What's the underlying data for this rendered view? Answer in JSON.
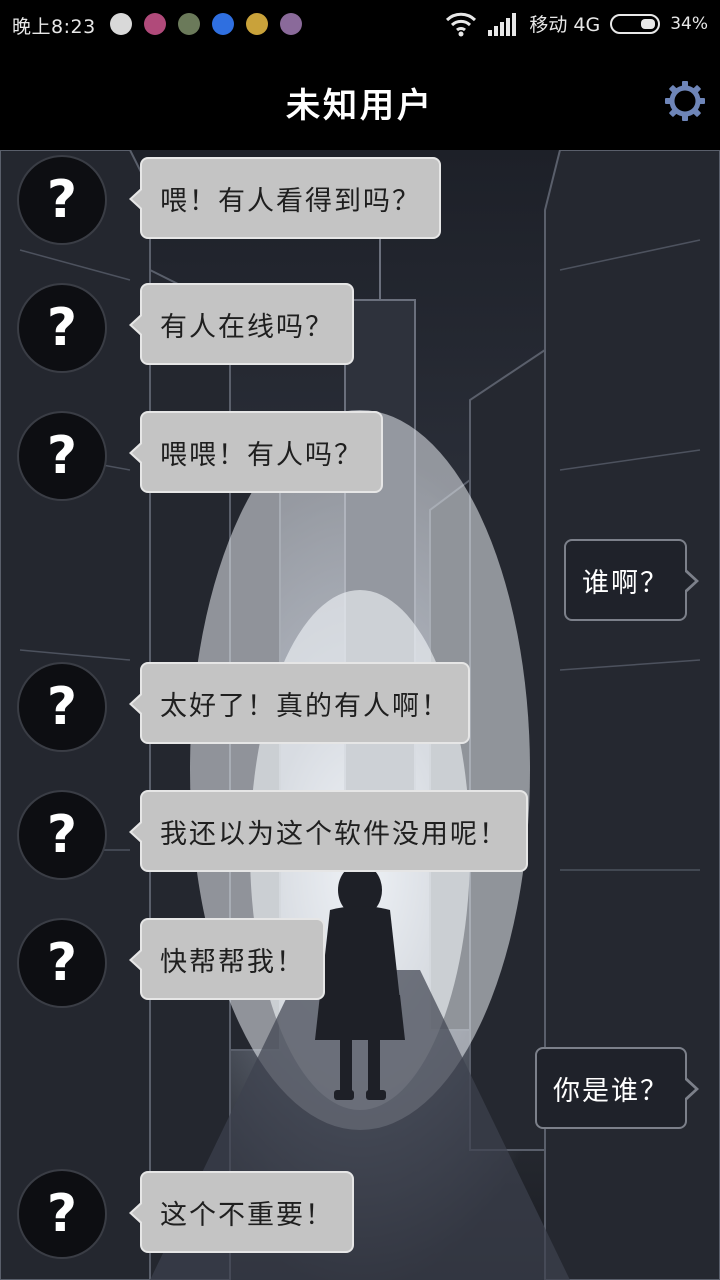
{
  "status_bar": {
    "time": "晚上8:23",
    "carrier": "移动 4G",
    "battery_percent": "34%",
    "battery_level": 0.34,
    "notification_icons": [
      "app-icon",
      "app-icon",
      "app-icon",
      "shield-check-icon",
      "app-icon",
      "app-icon"
    ],
    "notification_colors": [
      "#d9d9d9",
      "#b04a7a",
      "#6b7a5a",
      "#2f6fe0",
      "#c9a23a",
      "#8a6a9a"
    ]
  },
  "header": {
    "title": "未知用户",
    "settings_icon": "gear-icon",
    "accent_color": "#6e85b8"
  },
  "messages": [
    {
      "side": "incoming",
      "avatar_text": "?",
      "text": "喂！有人看得到吗？"
    },
    {
      "side": "incoming",
      "avatar_text": "?",
      "text": "有人在线吗？"
    },
    {
      "side": "incoming",
      "avatar_text": "?",
      "text": "喂喂！有人吗？"
    },
    {
      "side": "outgoing",
      "text": "谁啊？"
    },
    {
      "side": "incoming",
      "avatar_text": "?",
      "text": "太好了！真的有人啊！"
    },
    {
      "side": "incoming",
      "avatar_text": "?",
      "text": "我还以为这个软件没用呢！"
    },
    {
      "side": "incoming",
      "avatar_text": "?",
      "text": "快帮帮我！"
    },
    {
      "side": "outgoing",
      "text": "你是谁？"
    },
    {
      "side": "incoming",
      "avatar_text": "?",
      "text": "这个不重要！"
    }
  ]
}
